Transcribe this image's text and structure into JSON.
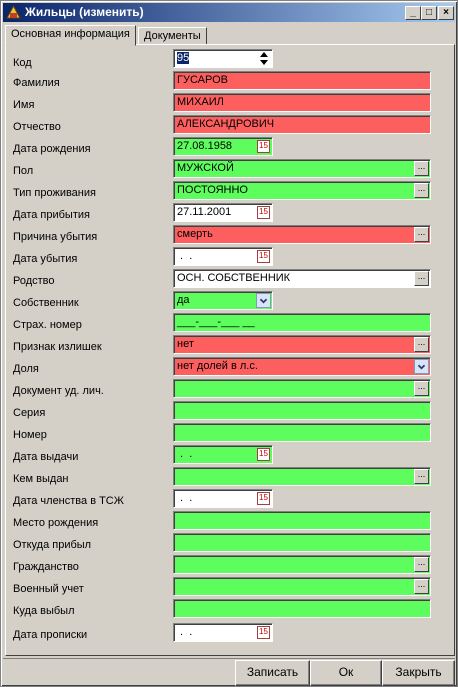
{
  "window": {
    "title": "Жильцы (изменить)"
  },
  "tabs": [
    {
      "label": "Основная информация",
      "active": true
    },
    {
      "label": "Документы",
      "active": false
    }
  ],
  "colors": {
    "required": "#5dfd5d",
    "error": "#fd5f5f",
    "normal": "#ffffff"
  },
  "fields": {
    "kod": {
      "label": "Код",
      "value": "95"
    },
    "familiya": {
      "label": "Фамилия",
      "value": "ГУСАРОВ"
    },
    "imya": {
      "label": "Имя",
      "value": "МИХАИЛ"
    },
    "otchestvo": {
      "label": "Отчество",
      "value": "АЛЕКСАНДРОВИЧ"
    },
    "data_rozhdeniya": {
      "label": "Дата рождения",
      "value": "27.08.1958"
    },
    "pol": {
      "label": "Пол",
      "value": "МУЖСКОЙ"
    },
    "tip_prozhivaniya": {
      "label": "Тип проживания",
      "value": "ПОСТОЯННО"
    },
    "data_pribytiya": {
      "label": "Дата прибытия",
      "value": "27.11.2001"
    },
    "prichina_ubytiya": {
      "label": "Причина убытия",
      "value": "смерть"
    },
    "data_ubytiya": {
      "label": "Дата убытия",
      "value": " .  ."
    },
    "rodstvo": {
      "label": "Родство",
      "value": "ОСН. СОБСТВЕННИК"
    },
    "sobstvennik": {
      "label": "Собственник",
      "value": "да"
    },
    "strah_nomer": {
      "label": "Страх. номер",
      "value": "___-___-___ __"
    },
    "priznak_izlishek": {
      "label": "Признак излишек",
      "value": "нет"
    },
    "dolya": {
      "label": "Доля",
      "value": "нет долей в л.с."
    },
    "dokument": {
      "label": "Документ уд. лич.",
      "value": ""
    },
    "seriya": {
      "label": "Серия",
      "value": ""
    },
    "nomer": {
      "label": "Номер",
      "value": ""
    },
    "data_vydachi": {
      "label": "Дата выдачи",
      "value": " .  ."
    },
    "kem_vydan": {
      "label": "Кем выдан",
      "value": ""
    },
    "data_chlenstva": {
      "label": "Дата членства в ТСЖ",
      "value": " .  ."
    },
    "mesto_rozhdeniya": {
      "label": "Место рождения",
      "value": ""
    },
    "otkuda_pribyl": {
      "label": "Откуда прибыл",
      "value": ""
    },
    "grazhdanstvo": {
      "label": "Гражданство",
      "value": ""
    },
    "voenny_uchet": {
      "label": "Военный учет",
      "value": ""
    },
    "kuda_vybyl": {
      "label": "Куда выбыл",
      "value": ""
    },
    "data_propiski": {
      "label": "Дата прописки",
      "value": " .  ."
    }
  },
  "buttons": {
    "save": "Записать",
    "ok": "Ок",
    "close": "Закрыть"
  },
  "icons": {
    "dots": "...",
    "calendar": "15"
  }
}
